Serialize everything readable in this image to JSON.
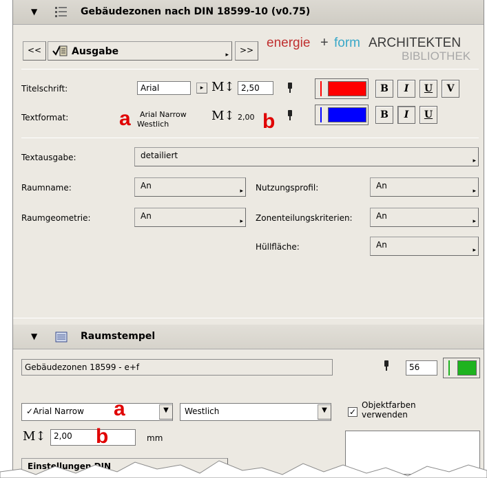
{
  "panel1": {
    "title": "Gebäudezonen nach DIN 18599-10 (v0.75)",
    "nav": {
      "prev": "<<",
      "next": ">>",
      "current": "Ausgabe"
    },
    "brand": {
      "energie": "energie",
      "plus": "+",
      "form": "form",
      "architekten": "ARCHITEKTEN",
      "bibliothek": "BIBLIOTHEK"
    },
    "titelschrift": {
      "label": "Titelschrift:",
      "font": "Arial",
      "size": "2,50",
      "bold": "B",
      "italic": "I",
      "underline": "U",
      "v": "V",
      "color": "#ff0000"
    },
    "textformat": {
      "label": "Textformat:",
      "font": "Arial Narrow",
      "style": "Westlich",
      "size": "2,00",
      "bold": "B",
      "italic": "I",
      "underline": "U",
      "color": "#0000ff"
    },
    "markers": {
      "a": "a",
      "b": "b"
    },
    "textausgabe": {
      "label": "Textausgabe:",
      "value": "detailiert"
    },
    "raumname": {
      "label": "Raumname:",
      "value": "An"
    },
    "raumgeometrie": {
      "label": "Raumgeometrie:",
      "value": "An"
    },
    "nutzungsprofil": {
      "label": "Nutzungsprofil:",
      "value": "An"
    },
    "zonenteilung": {
      "label": "Zonenteilungskriterien:",
      "value": "An"
    },
    "huellflaeche": {
      "label": "Hüllfläche:",
      "value": "An"
    }
  },
  "panel2": {
    "title": "Raumstempel",
    "stamp_name": "Gebäudezonen 18599 - e+f",
    "pen_number": "56",
    "pen_color": "#1fb31f",
    "font": "Arial Narrow",
    "style": "Westlich",
    "objektfarben": "Objektfarben verwenden",
    "objektfarben_checked": "✓",
    "size": "2,00",
    "unit": "mm",
    "markers": {
      "a": "a",
      "b": "b"
    },
    "bottom_button": "Einstellungen DIN"
  }
}
